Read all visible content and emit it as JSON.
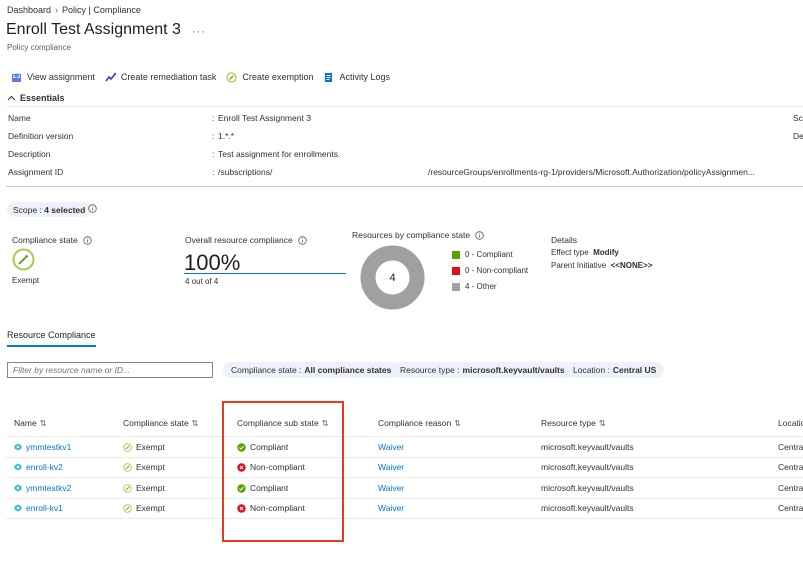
{
  "breadcrumb": [
    "Dashboard",
    "Policy | Compliance"
  ],
  "title": "Enroll Test Assignment 3",
  "more": "···",
  "subtitle": "Policy compliance",
  "toolbar": [
    {
      "label": "View assignment",
      "icon": "view-assignment-icon"
    },
    {
      "label": "Create remediation task",
      "icon": "remediation-icon"
    },
    {
      "label": "Create exemption",
      "icon": "exemption-icon"
    },
    {
      "label": "Activity Logs",
      "icon": "activity-log-icon"
    }
  ],
  "essentials": {
    "header": "Essentials",
    "rows": [
      {
        "label": "Name",
        "value": "Enroll Test Assignment 3",
        "right": "Sc"
      },
      {
        "label": "Definition version",
        "value": "1.*.*",
        "right": "De"
      },
      {
        "label": "Description",
        "value": "Test assignment for enrollments."
      },
      {
        "label": "Assignment ID",
        "value": "/subscriptions/",
        "value2": "/resourceGroups/enrollments-rg-1/providers/Microsoft.Authorization/policyAssignmen..."
      }
    ]
  },
  "scope": {
    "label": "Scope :",
    "value": "4 selected"
  },
  "compliance_state": {
    "label": "Compliance state",
    "value": "Exempt"
  },
  "overall": {
    "label": "Overall resource compliance",
    "percent": "100%",
    "sub": "4 out of 4"
  },
  "donut": {
    "label": "Resources by compliance state",
    "center": "4",
    "legend": [
      {
        "text": "0 - Compliant",
        "color": "#57a300"
      },
      {
        "text": "0 - Non-compliant",
        "color": "#e00b1c"
      },
      {
        "text": "4 - Other",
        "color": "#a0a0a0"
      }
    ]
  },
  "details": {
    "title": "Details",
    "effect_label": "Effect type",
    "effect_value": "Modify",
    "parent_label": "Parent Initiative",
    "parent_value": "<<NONE>>"
  },
  "tab": "Resource Compliance",
  "filter": {
    "placeholder": "Filter by resource name or ID...",
    "pills": [
      {
        "label": "Compliance state :",
        "value": "All compliance states"
      },
      {
        "label": "Resource type :",
        "value": "microsoft.keyvault/vaults"
      },
      {
        "label": "Location :",
        "value": "Central US"
      }
    ]
  },
  "table": {
    "headers": [
      "Name",
      "Compliance state",
      "Compliance sub state",
      "Compliance reason",
      "Resource type",
      "Locatio"
    ],
    "rows": [
      {
        "name": "ymmtestkv1",
        "state": "Exempt",
        "sub": "Compliant",
        "sub_ok": true,
        "reason": "Waiver",
        "type": "microsoft.keyvault/vaults",
        "loc": "Centra"
      },
      {
        "name": "enroll-kv2",
        "state": "Exempt",
        "sub": "Non-compliant",
        "sub_ok": false,
        "reason": "Waiver",
        "type": "microsoft.keyvault/vaults",
        "loc": "Centra"
      },
      {
        "name": "ymmtestkv2",
        "state": "Exempt",
        "sub": "Compliant",
        "sub_ok": true,
        "reason": "Waiver",
        "type": "microsoft.keyvault/vaults",
        "loc": "Centra"
      },
      {
        "name": "enroll-kv1",
        "state": "Exempt",
        "sub": "Non-compliant",
        "sub_ok": false,
        "reason": "Waiver",
        "type": "microsoft.keyvault/vaults",
        "loc": "Centra"
      }
    ]
  },
  "colors": {
    "accent": "#0078d4",
    "highlight": "#e83a1f",
    "compliant": "#57a300",
    "noncompliant": "#e00b1c"
  }
}
